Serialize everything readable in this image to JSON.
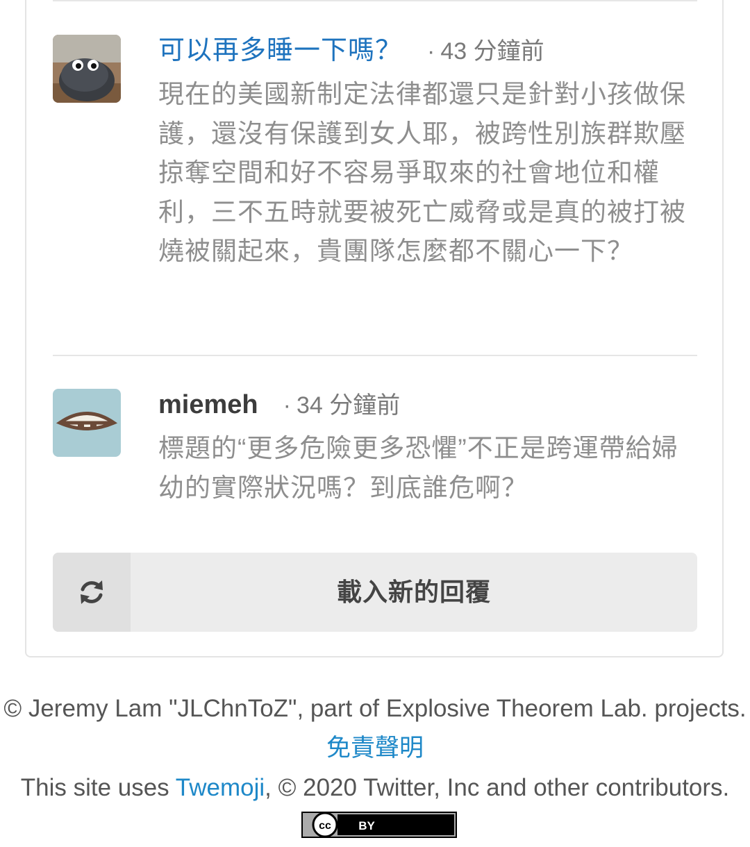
{
  "comments": [
    {
      "author": "可以再多睡一下嗎？",
      "time_dot": "·",
      "time": "43 分鐘前",
      "body": "現在的美國新制定法律都還只是針對小孩做保護，還沒有保護到女人耶，被跨性別族群欺壓掠奪空間和好不容易爭取來的社會地位和權利，三不五時就要被死亡威脅或是真的被打被燒被關起來，貴團隊怎麼都不關心一下？"
    },
    {
      "author": "miemeh",
      "time_dot": "·",
      "time": "34 分鐘前",
      "body": "標題的“更多危險更多恐懼”不正是跨運帶給婦幼的實際狀況嗎？到底誰危啊？"
    }
  ],
  "load_button": {
    "icon": "refresh-icon",
    "label": "載入新的回覆"
  },
  "footer": {
    "copyright_pre": "© Jeremy Lam \"JLChnToZ\", part of Explosive Theorem Lab. projects.",
    "disclaimer_link": "免責聲明",
    "twemoji_pre": "This site uses",
    "twemoji_link": "Twemoji",
    "twemoji_post": ", © 2020 Twitter, Inc and other contributors.",
    "cc_badge_text": "cc",
    "cc_badge_by": "BY"
  },
  "colors": {
    "link": "#1e73be",
    "footer_link": "#1e88c8",
    "body_text": "#8e8e8e",
    "button_bg": "#ececec"
  }
}
